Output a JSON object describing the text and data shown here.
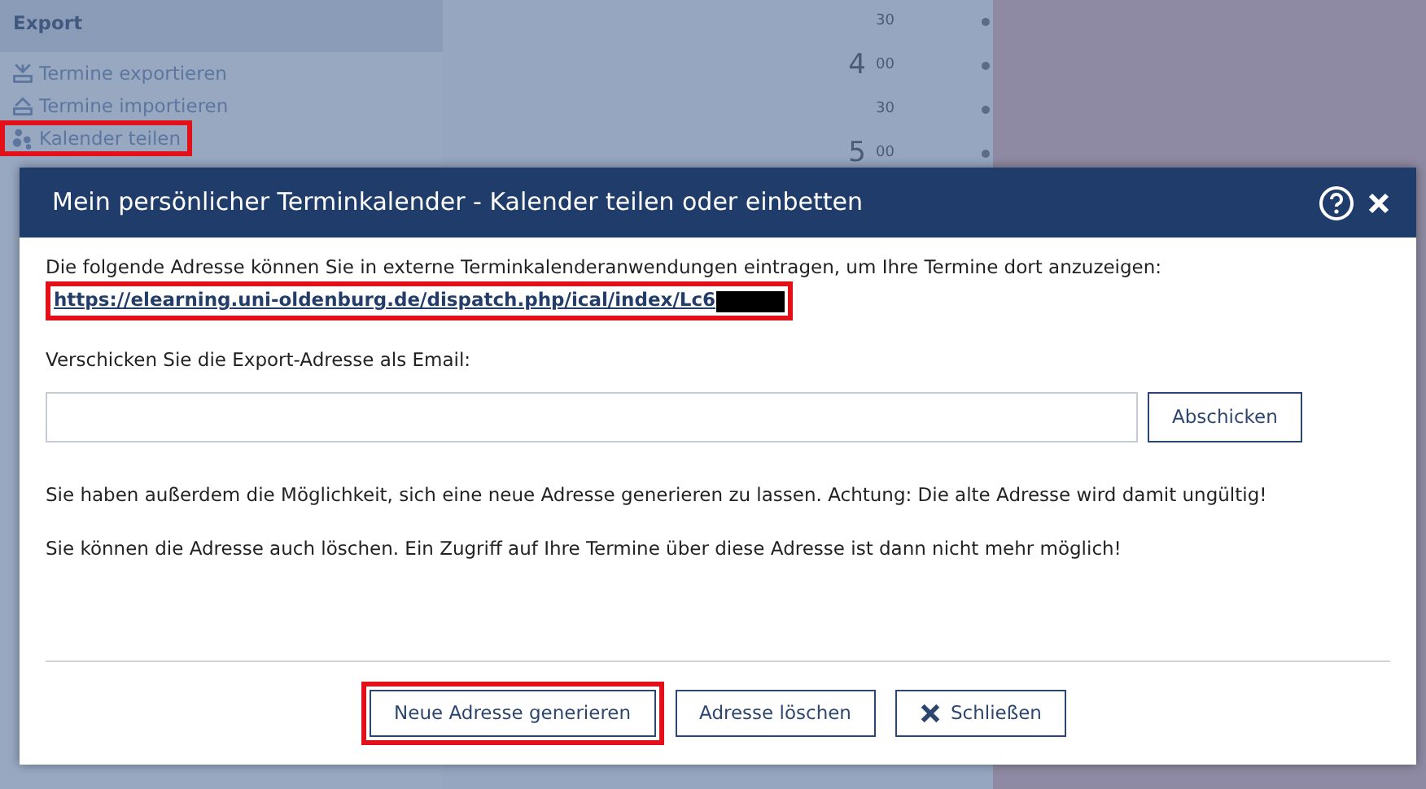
{
  "background": {
    "sidebar": {
      "heading": "Export",
      "items": [
        {
          "label": "Termine exportieren",
          "highlighted": false
        },
        {
          "label": "Termine importieren",
          "highlighted": false
        },
        {
          "label": "Kalender teilen",
          "highlighted": true
        }
      ]
    },
    "time_slots": [
      {
        "minute": "30"
      },
      {
        "hour": "4",
        "minute": "00"
      },
      {
        "minute": "30"
      },
      {
        "hour": "5",
        "minute": "00"
      }
    ]
  },
  "dialog": {
    "title": "Mein persönlicher Terminkalender - Kalender teilen oder einbetten",
    "intro": "Die folgende Adresse können Sie in externe Terminkalenderanwendungen eintragen, um Ihre Termine dort anzuzeigen:",
    "link": {
      "text": "https://elearning.uni-oldenburg.de/dispatch.php/ical/index/Lc6",
      "redacted": true,
      "highlighted": true
    },
    "email_label": "Verschicken Sie die Export-Adresse als Email:",
    "email_button": "Abschicken",
    "info": [
      "Sie haben außerdem die Möglichkeit, sich eine neue Adresse generieren zu lassen. Achtung: Die alte Adresse wird damit ungültig!",
      "Sie können die Adresse auch löschen. Ein Zugriff auf Ihre Termine über diese Adresse ist dann nicht mehr möglich!"
    ],
    "buttons": [
      {
        "label": "Neue Adresse generieren",
        "kind": "plain",
        "highlighted": true
      },
      {
        "label": "Adresse löschen",
        "kind": "plain",
        "highlighted": false
      },
      {
        "label": "Schließen",
        "kind": "close",
        "highlighted": false
      }
    ]
  }
}
